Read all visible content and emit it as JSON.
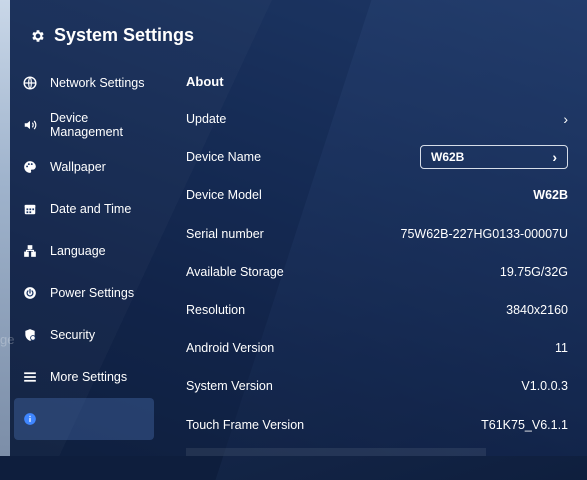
{
  "header": {
    "title": "System Settings",
    "icon": "gear-icon"
  },
  "sidebar": {
    "items": [
      {
        "label": "Network Settings",
        "icon": "globe-icon"
      },
      {
        "label": "Device Management",
        "icon": "speaker-icon"
      },
      {
        "label": "Wallpaper",
        "icon": "palette-icon"
      },
      {
        "label": "Date and Time",
        "icon": "calendar-icon"
      },
      {
        "label": "Language",
        "icon": "language-icon"
      },
      {
        "label": "Power Settings",
        "icon": "power-icon"
      },
      {
        "label": "Security",
        "icon": "shield-icon"
      },
      {
        "label": "More Settings",
        "icon": "list-icon"
      },
      {
        "label": "",
        "icon": "info-icon",
        "active": true
      }
    ]
  },
  "ghost_text": "ge",
  "about": {
    "title": "About",
    "update_label": "Update",
    "device_name_label": "Device Name",
    "device_name_value": "W62B",
    "rows": [
      {
        "label": "Device Model",
        "value": "W62B"
      },
      {
        "label": "Serial number",
        "value": "75W62B-227HG0133-00007U"
      },
      {
        "label": "Available Storage",
        "value": "19.75G/32G"
      },
      {
        "label": "Resolution",
        "value": "3840x2160"
      },
      {
        "label": "Android Version",
        "value": "11"
      },
      {
        "label": "System Version",
        "value": "V1.0.0.3"
      },
      {
        "label": "Touch Frame Version",
        "value": "T61K75_V6.1.1"
      }
    ]
  }
}
